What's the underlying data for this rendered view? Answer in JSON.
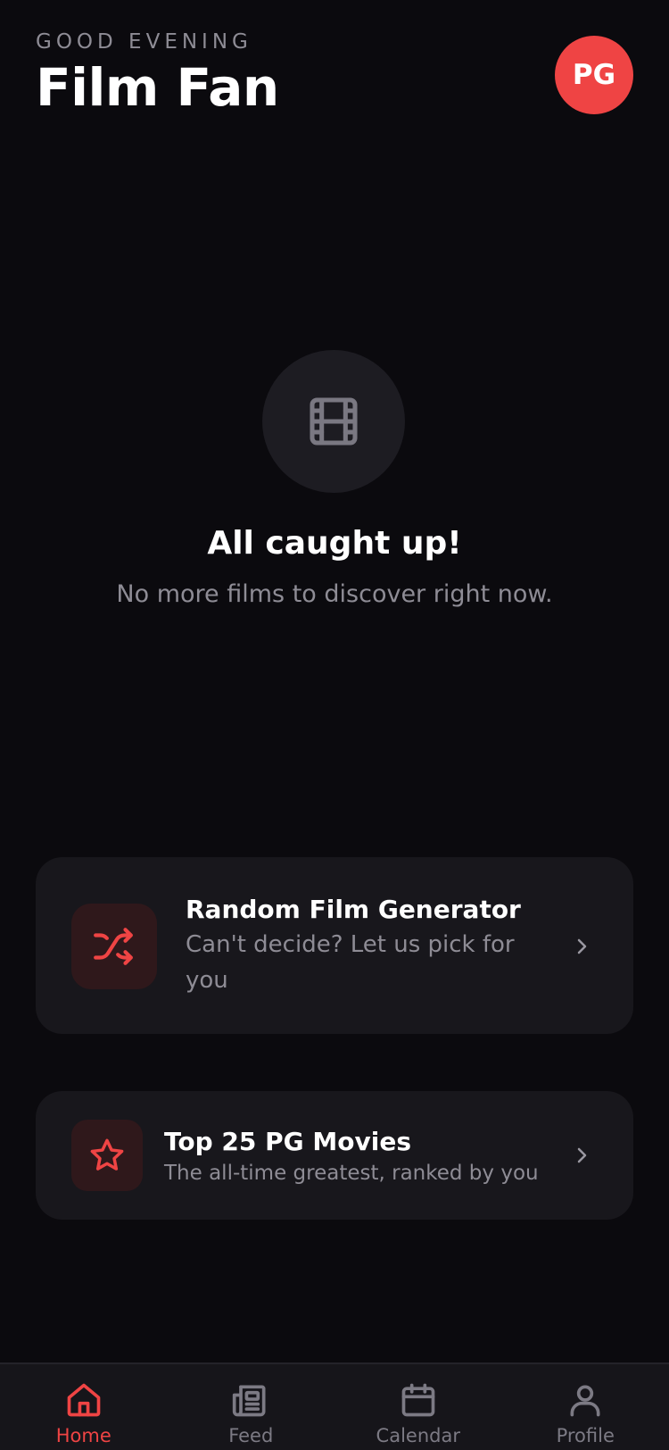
{
  "header": {
    "greeting": "GOOD EVENING",
    "title": "Film Fan",
    "avatar_initials": "PG"
  },
  "empty_state": {
    "icon": "film-icon",
    "title": "All caught up!",
    "subtitle": "No more films to discover right now."
  },
  "cards": [
    {
      "icon": "shuffle-icon",
      "title": "Random Film Generator",
      "subtitle": "Can't decide? Let us pick for you"
    },
    {
      "icon": "star-icon",
      "title": "Top 25 PG Movies",
      "subtitle": "The all-time greatest, ranked by you"
    }
  ],
  "tabbar": {
    "items": [
      {
        "label": "Home",
        "icon": "home-icon",
        "active": true
      },
      {
        "label": "Feed",
        "icon": "newspaper-icon",
        "active": false
      },
      {
        "label": "Calendar",
        "icon": "calendar-icon",
        "active": false
      },
      {
        "label": "Profile",
        "icon": "user-icon",
        "active": false
      }
    ]
  },
  "colors": {
    "background": "#0b0a0e",
    "accent": "#ef4444",
    "card": "#18171c",
    "muted_text": "#8e8c95"
  }
}
